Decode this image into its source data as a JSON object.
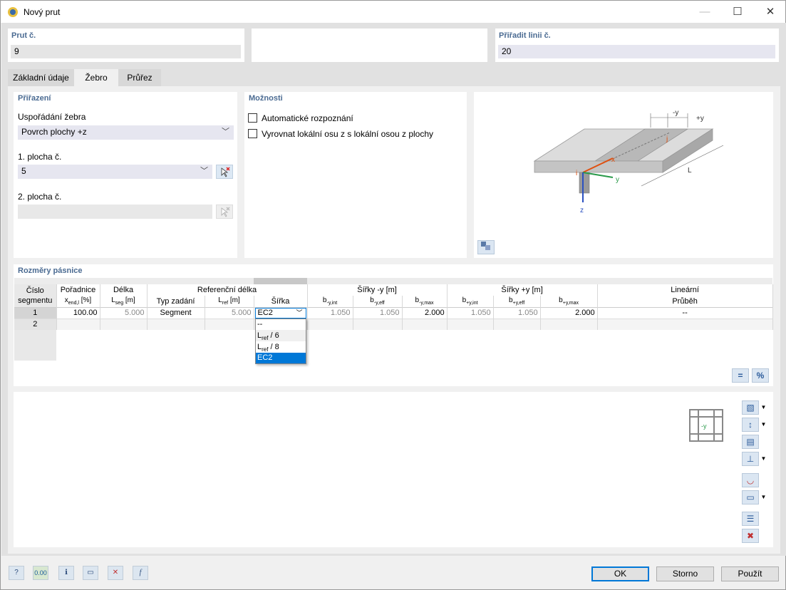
{
  "window": {
    "title": "Nový prut"
  },
  "top": {
    "member_no_label": "Prut č.",
    "member_no_value": "9",
    "assign_line_label": "Přiřadit linii č.",
    "assign_line_value": "20"
  },
  "tabs": [
    {
      "label": "Základní údaje"
    },
    {
      "label": "Žebro"
    },
    {
      "label": "Průřez"
    }
  ],
  "assignment": {
    "header": "Přiřazení",
    "arrangement_label": "Uspořádání žebra",
    "arrangement_value": "Povrch plochy +z",
    "surface1_label": "1. plocha č.",
    "surface1_value": "5",
    "surface2_label": "2. plocha č.",
    "surface2_value": ""
  },
  "options": {
    "header": "Možnosti",
    "auto_detect_label": "Automatické rozpoznání",
    "align_axis_label": "Vyrovnat lokální osu z s lokální osou z plochy"
  },
  "diagram": {
    "neg_y": "-y",
    "pos_y": "+y",
    "j": "j",
    "i": "i",
    "x": "x",
    "y": "y",
    "z": "z",
    "L": "L"
  },
  "flange": {
    "header": "Rozměry pásnice",
    "columns": {
      "seg_no": "Číslo segmentu",
      "coord": "Pořadnice",
      "coord_sub": "x",
      "coord_sub2": "end,l",
      "coord_unit": "[%]",
      "length": "Délka",
      "length_sub": "L",
      "length_sub2": "seg",
      "length_unit": "[m]",
      "ref_len": "Referenční délka",
      "input_type": "Typ zadání",
      "lref": "L",
      "lref_sub": "ref",
      "lref_unit": "[m]",
      "width": "Šířka",
      "widths_neg": "Šířky -y [m]",
      "widths_pos": "Šířky +y [m]",
      "b": "b",
      "neg_int_sub": "-y,int",
      "neg_eff_sub": "-y,eff",
      "neg_max_sub": "-y,max",
      "pos_int_sub": "+y,int",
      "pos_eff_sub": "+y,eff",
      "pos_max_sub": "+y,max",
      "linear": "Lineární",
      "course": "Průběh"
    },
    "rows": [
      {
        "no": "1",
        "coord": "100.00",
        "length": "5.000",
        "type": "Segment",
        "lref": "5.000",
        "width": "EC2",
        "neg_int": "1.050",
        "neg_eff": "1.050",
        "neg_max": "2.000",
        "pos_int": "1.050",
        "pos_eff": "1.050",
        "pos_max": "2.000",
        "linear": "--"
      },
      {
        "no": "2"
      }
    ],
    "width_options": [
      {
        "label": "--",
        "sub": ""
      },
      {
        "label": "L",
        "sub": "ref",
        "rest": " / 6"
      },
      {
        "label": "L",
        "sub": "ref",
        "rest": " / 8"
      },
      {
        "label": "EC2",
        "sub": ""
      }
    ]
  },
  "preview": {
    "axis_label": "-y"
  },
  "buttons": {
    "ok": "OK",
    "cancel": "Storno",
    "apply": "Použít"
  },
  "toolbar": {
    "units_label": "0.00"
  },
  "colors": {
    "header_blue": "#4b6b92",
    "selection": "#0078d7"
  }
}
